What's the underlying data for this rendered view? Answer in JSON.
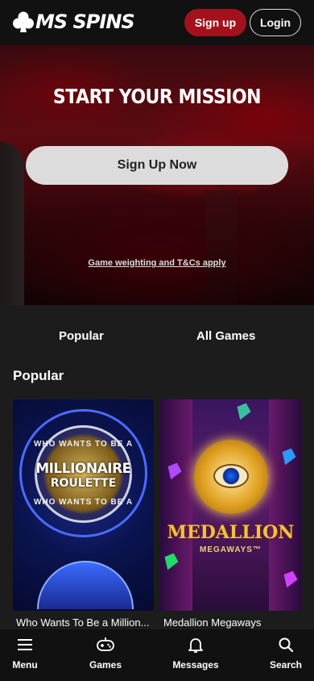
{
  "header": {
    "logo_text": "MS SPINS",
    "signup_label": "Sign up",
    "login_label": "Login"
  },
  "hero": {
    "title": "START YOUR MISSION",
    "cta_label": "Sign Up Now",
    "terms_link": "Game weighting and T&Cs apply"
  },
  "tabs": [
    {
      "label": "Popular"
    },
    {
      "label": "All Games"
    }
  ],
  "section": {
    "title": "Popular"
  },
  "games": [
    {
      "name": "Who Wants To Be a Million...",
      "art_top": "WHO WANTS TO BE A",
      "art_title": "MILLIONAIRE",
      "art_subtitle": "ROULETTE",
      "art_bottom": "WHO WANTS TO BE A"
    },
    {
      "name": "Medallion Megaways",
      "art_title": "MEDALLION",
      "art_subtitle": "MEGAWAYS™"
    }
  ],
  "bottom_nav": [
    {
      "label": "Menu",
      "icon": "menu-icon"
    },
    {
      "label": "Games",
      "icon": "gamepad-icon"
    },
    {
      "label": "Messages",
      "icon": "bell-icon"
    },
    {
      "label": "Search",
      "icon": "search-icon"
    }
  ],
  "colors": {
    "accent": "#a3121c",
    "background": "#1c1c1c",
    "header": "#111111",
    "cta": "#dcdcdc"
  }
}
